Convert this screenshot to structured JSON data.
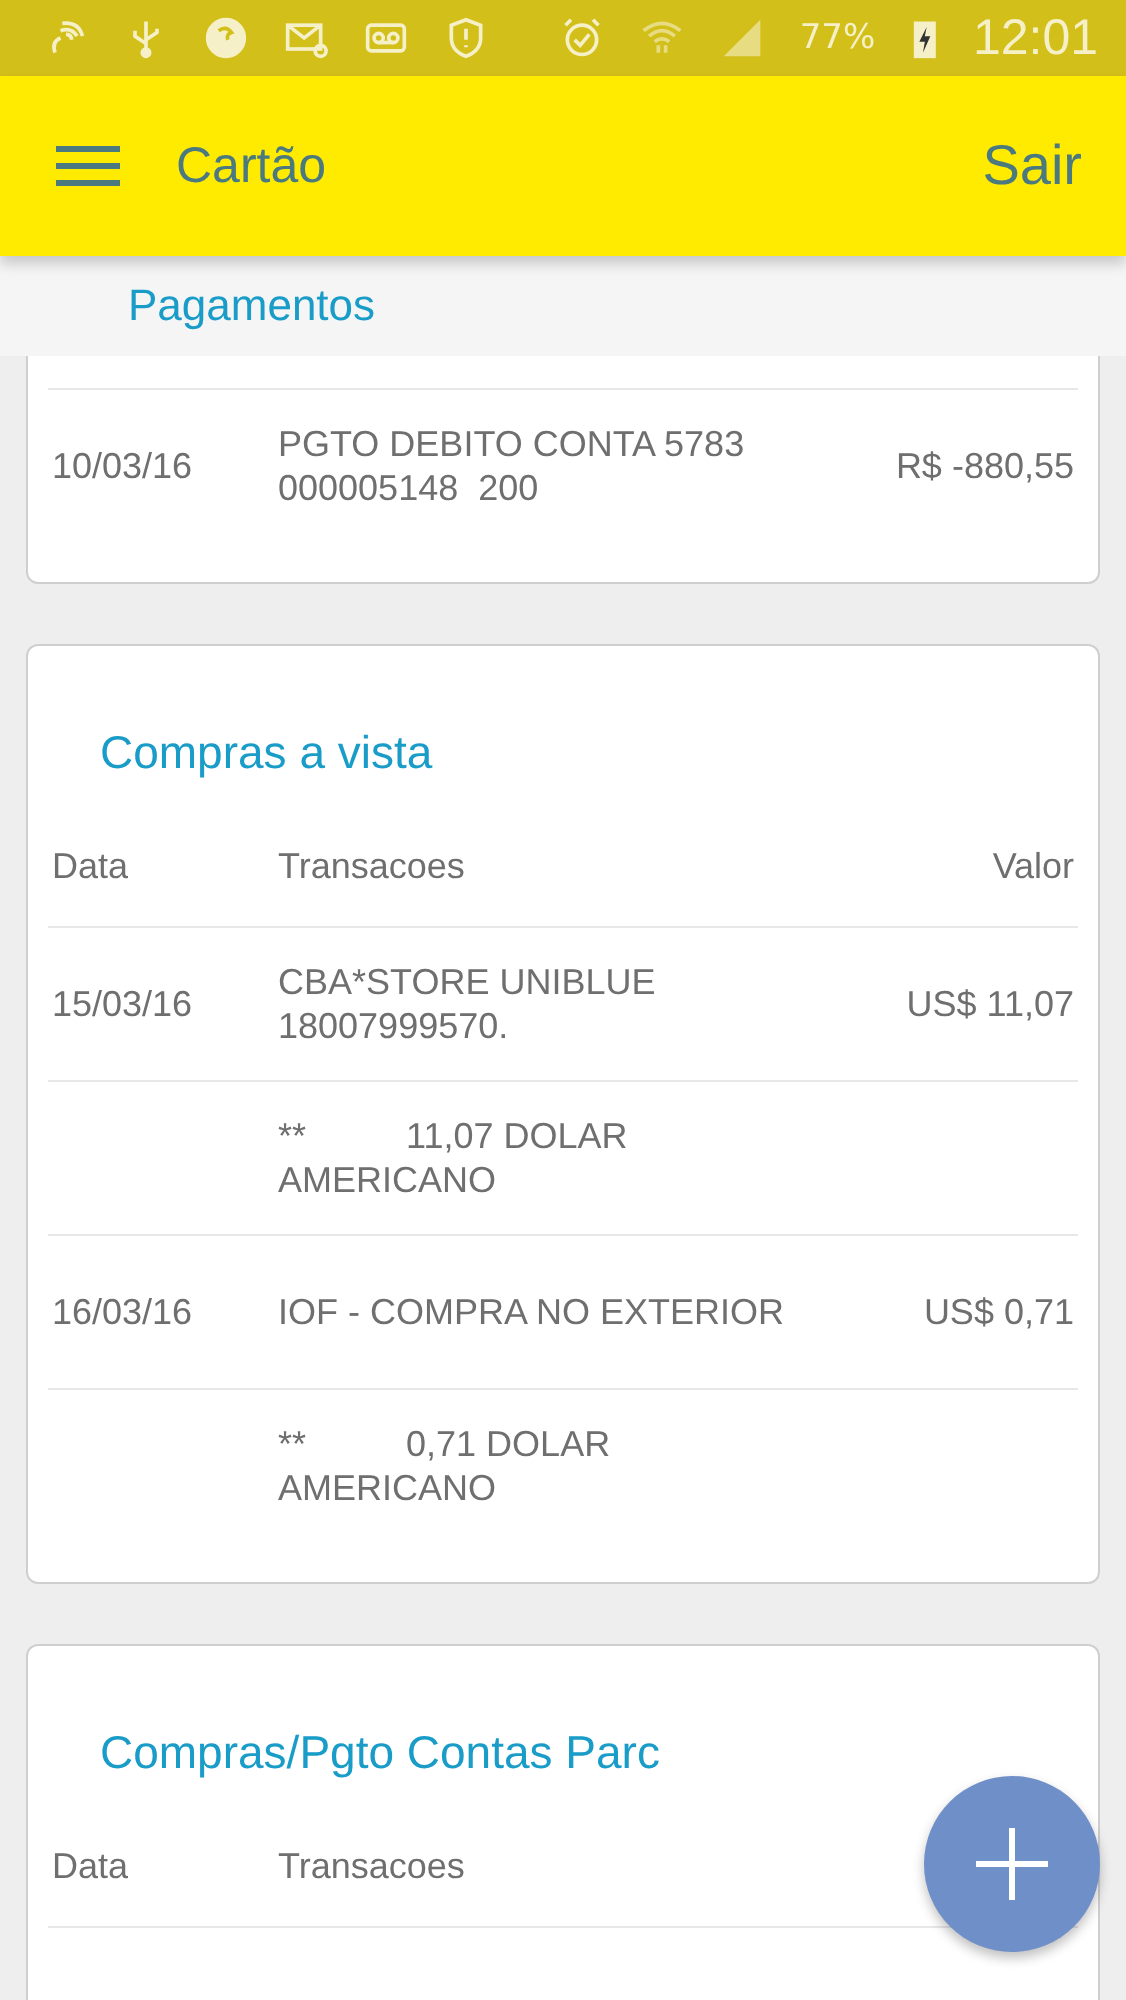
{
  "status_bar": {
    "battery": "77%",
    "time": "12:01"
  },
  "toolbar": {
    "title": "Cartão",
    "action": "Sair"
  },
  "sticky_header": "Pagamentos",
  "sections": [
    {
      "rows": [
        {
          "date": "10/03/16",
          "description": [
            "PGTO DEBITO CONTA 5783",
            "000005148  200"
          ],
          "value": "R$ -880,55"
        }
      ]
    },
    {
      "title": "Compras a vista",
      "columns": [
        "Data",
        "Transacoes",
        "Valor"
      ],
      "rows": [
        {
          "date": "15/03/16",
          "description": [
            "CBA*STORE UNIBLUE",
            "18007999570."
          ],
          "value": "US$ 11,07"
        },
        {
          "description": [
            "**          11,07 DOLAR",
            "AMERICANO"
          ]
        },
        {
          "date": "16/03/16",
          "description": [
            "IOF - COMPRA NO EXTERIOR"
          ],
          "value": "US$ 0,71"
        },
        {
          "description": [
            "**          0,71 DOLAR",
            "AMERICANO"
          ]
        }
      ]
    },
    {
      "title": "Compras/Pgto Contas Parc",
      "columns": [
        "Data",
        "Transacoes"
      ]
    }
  ]
}
